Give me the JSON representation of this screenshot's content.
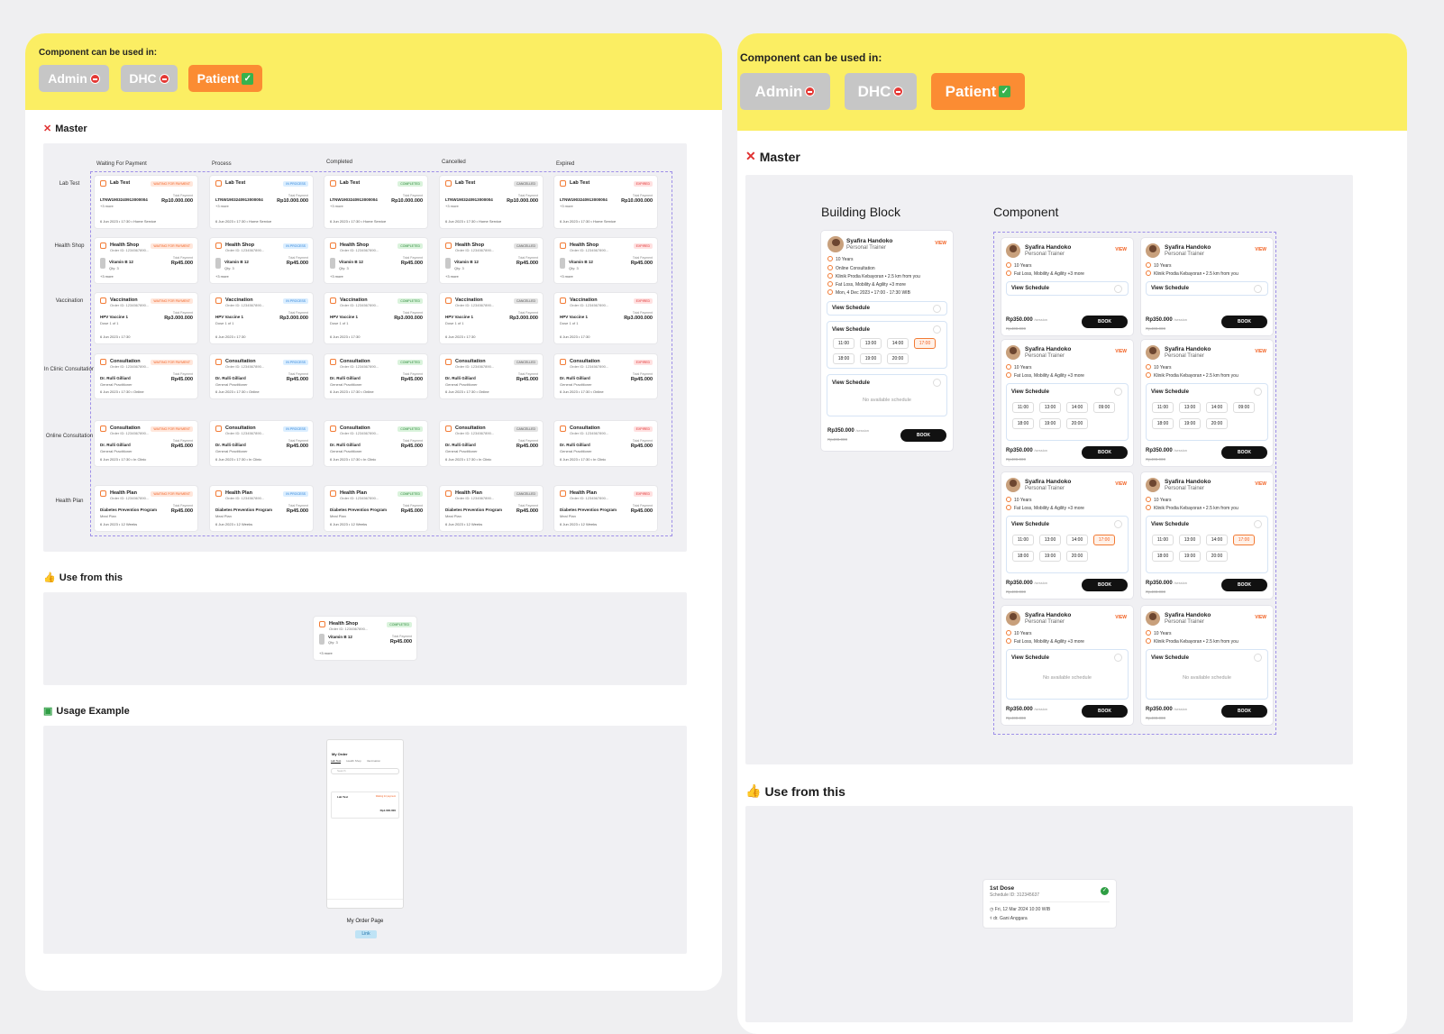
{
  "left": {
    "caption": "Component can be used in:",
    "chips": [
      "Admin",
      "DHC",
      "Patient"
    ],
    "master_title": "Master",
    "columns": [
      "Waiting For Payment",
      "Process",
      "Completed",
      "Cancelled",
      "Expired"
    ],
    "rows": [
      {
        "label": "Lab Test",
        "title": "Lab Test",
        "order": "Order ID",
        "line1": "LTNW1903240913000004",
        "line2": "+3 more",
        "total_label": "Total Payment",
        "amount": "Rp10.000.000",
        "date": "6 Jun 2023 • 17:30 • Home Service"
      },
      {
        "label": "Health Shop",
        "title": "Health Shop",
        "order": "Order ID: 1234567890...",
        "line1": "Vitamin B 12",
        "line2": "Qty: 3",
        "total_label": "Total Payment",
        "amount": "Rp45.000",
        "date": "+3 more"
      },
      {
        "label": "Vaccination",
        "title": "Vaccination",
        "order": "Order ID: 1234567890...",
        "line1": "HPV Vaccine 1",
        "line2": "Dose 1 of 1",
        "total_label": "Total Payment",
        "amount": "Rp3.000.000",
        "date": "6 Jun 2023 • 17:30"
      },
      {
        "label": "In Clinic Consultation",
        "title": "Consultation",
        "order": "Order ID: 1234567890...",
        "line1": "Dr. Rulli Gilliard",
        "line2": "General Practitioner",
        "total_label": "Total Payment",
        "amount": "Rp45.000",
        "date": "6 Jun 2023 • 17:30 • Online"
      },
      {
        "label": "Online Consultation",
        "title": "Consultation",
        "order": "Order ID: 1234567890...",
        "line1": "Dr. Rulli Gilliard",
        "line2": "General Practitioner",
        "total_label": "Total Payment",
        "amount": "Rp45.000",
        "date": "6 Jun 2023 • 17:30 • In Clinic"
      },
      {
        "label": "Health Plan",
        "title": "Health Plan",
        "order": "Order ID: 1234567890...",
        "line1": "Diabetes Prevention Program",
        "line2": "Meal Plan",
        "total_label": "Total Payment",
        "amount": "Rp45.000",
        "date": "6 Jun 2023 • 12 Weeks"
      }
    ],
    "badges": [
      "WAITING FOR PAYMENT",
      "IN PROCESS",
      "COMPLETED",
      "CANCELLED",
      "EXPIRED"
    ],
    "use_title": "Use from this",
    "use_card": {
      "title": "Health Shop",
      "order": "Order ID: 1234567890...",
      "badge": "COMPLETED",
      "item": "Vitamin B 12",
      "qty": "Qty: 3",
      "total_label": "Total Payment",
      "amount": "Rp45.000",
      "more": "+3 more"
    },
    "usage_title": "Usage Example",
    "phone": {
      "title": "My Order",
      "tabs": [
        "Lab Test",
        "Health Shop",
        "Vaccination"
      ],
      "search": "Search",
      "card_title": "Lab Test",
      "card_badge": "Waiting for payment",
      "card_amount": "Rp1.000.000",
      "caption": "My Order Page",
      "link": "Link"
    }
  },
  "right": {
    "caption": "Component can be used in:",
    "chips": [
      "Admin",
      "DHC",
      "Patient"
    ],
    "master_title": "Master",
    "bb_title": "Building Block",
    "comp_title": "Component",
    "trainer": {
      "name": "Syafira Handoko",
      "role": "Personal Trainer",
      "view": "VIEW",
      "years": "10 Years",
      "online": "Online Consultation",
      "clinic": "Klinik Prodia Kebayoran • 2.5 km from you",
      "focus": "Fat Loss, Mobility & Agility +3 more",
      "date": "Mon, 4 Dec 2023 • 17:00 - 17:30 WIB",
      "schedule": "View Schedule",
      "no_schedule": "No available schedule",
      "price": "Rp350.000",
      "per": "/session",
      "strike": "Rp400.000",
      "book": "BOOK"
    },
    "slots": [
      "11:00",
      "13:00",
      "14:00",
      "17:00",
      "18:00",
      "19:00",
      "20:00"
    ],
    "slots2": [
      "11:00",
      "13:00",
      "14:00",
      "09:00",
      "18:00",
      "19:00",
      "20:00"
    ],
    "use_title": "Use from this",
    "dose": {
      "title": "1st Dose",
      "schedule": "Schedule ID: 312345637",
      "date": "Fri, 12 Mar 2024 10:30 WIB",
      "doctor": "dr. Gani Anggara"
    }
  }
}
